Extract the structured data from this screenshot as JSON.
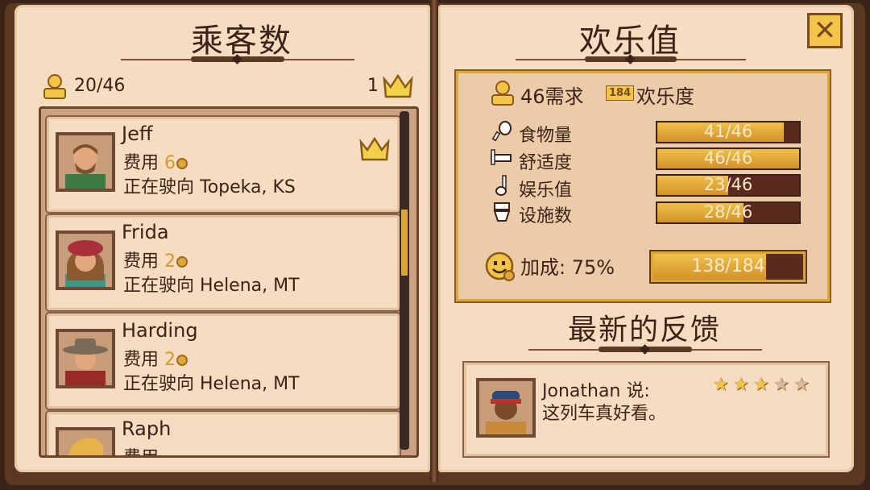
{
  "left_page": {
    "title": "乘客数",
    "passenger_count": "20/46",
    "vip_count": "1",
    "passengers": [
      {
        "name": "Jeff",
        "fee_label": "费用",
        "fee": "6",
        "destination": "正在驶向 Topeka, KS",
        "vip": true
      },
      {
        "name": "Frida",
        "fee_label": "费用",
        "fee": "2",
        "destination": "正在驶向 Helena, MT",
        "vip": false
      },
      {
        "name": "Harding",
        "fee_label": "费用",
        "fee": "2",
        "destination": "正在驶向 Helena, MT",
        "vip": false
      },
      {
        "name": "Raph",
        "fee_label": "费用",
        "fee": "",
        "destination": "",
        "vip": false
      }
    ]
  },
  "right_page": {
    "title": "欢乐值",
    "demand_count": "46需求",
    "demand_points": "184",
    "demand_suffix": "欢乐度",
    "stats": [
      {
        "icon": "food-icon",
        "label": "食物量",
        "value": 41,
        "max": 46,
        "text": "41/46"
      },
      {
        "icon": "bed-icon",
        "label": "舒适度",
        "value": 46,
        "max": 46,
        "text": "46/46"
      },
      {
        "icon": "music-note-icon",
        "label": "娱乐值",
        "value": 23,
        "max": 46,
        "text": "23/46"
      },
      {
        "icon": "toilet-icon",
        "label": "设施数",
        "value": 28,
        "max": 46,
        "text": "28/46"
      }
    ],
    "bonus_label": "加成: 75%",
    "bonus": {
      "value": 138,
      "max": 184,
      "text": "138/184"
    },
    "feedback_title": "最新的反馈",
    "feedback": {
      "speaker": "Jonathan 说:",
      "message": "这列车真好看。",
      "stars_filled": 3,
      "stars_total": 5
    }
  },
  "close_label": "✕",
  "colors": {
    "page": "#f6dcc0",
    "bar_fill": "#e0a83a",
    "bar_empty": "#5b2a1e",
    "accent_gold": "#f3c44a",
    "text": "#3b2417"
  }
}
